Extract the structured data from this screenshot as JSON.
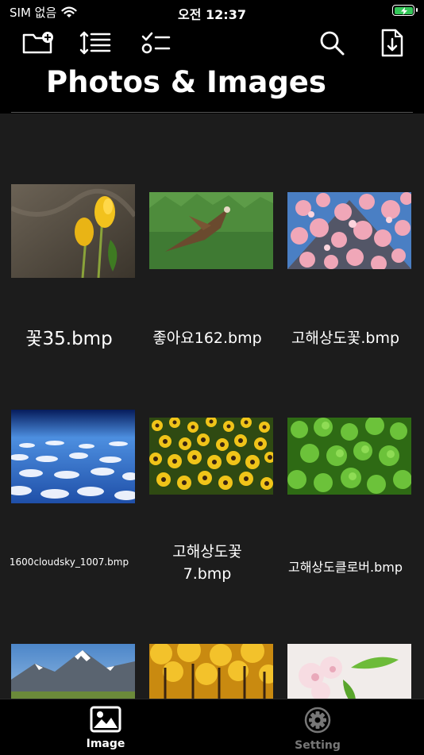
{
  "status_bar": {
    "carrier": "SIM 없음",
    "time": "오전 12:37"
  },
  "toolbar": {
    "new_folder": "folder-plus-icon",
    "sort": "sort-icon",
    "select": "checklist-icon",
    "search": "search-icon",
    "download": "download-icon"
  },
  "page": {
    "title": "Photos & Images"
  },
  "items": [
    {
      "name": "꽃35.bmp"
    },
    {
      "name": "좋아요162.bmp"
    },
    {
      "name": "고해상도꽃.bmp"
    },
    {
      "name": "1600cloudsky_1007.bmp"
    },
    {
      "name": "고해상도꽃\n7.bmp"
    },
    {
      "name": "고해상도클로버.bmp"
    },
    {
      "name": ""
    },
    {
      "name": ""
    },
    {
      "name": ""
    }
  ],
  "tabbar": {
    "tabs": [
      {
        "label": "Image",
        "icon": "image-icon",
        "active": true
      },
      {
        "label": "Setting",
        "icon": "gear-icon",
        "active": false
      }
    ]
  },
  "colors": {
    "active_tab": "#ffffff",
    "inactive_tab": "#777777",
    "battery": "#34c759"
  }
}
